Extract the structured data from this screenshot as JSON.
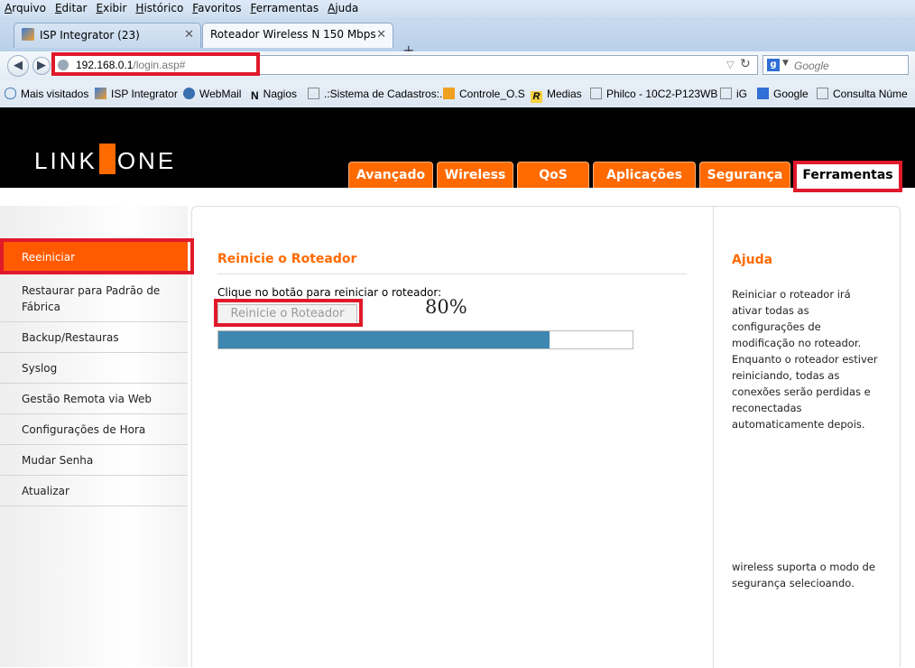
{
  "browser": {
    "menu": [
      "Arquivo",
      "Editar",
      "Exibir",
      "Histórico",
      "Favoritos",
      "Ferramentas",
      "Ajuda"
    ],
    "tabs": [
      {
        "label": "ISP Integrator (23)",
        "active": false
      },
      {
        "label": "Roteador Wireless N 150 Mbps",
        "active": true
      }
    ],
    "new_tab": "+",
    "close_glyph": "✕",
    "url_host": "192.168.0.1",
    "url_path": "/login.asp#",
    "search_placeholder": "Google",
    "bookmarks": [
      "Mais visitados",
      "ISP Integrator",
      "WebMail",
      "Nagios",
      ".:Sistema de Cadastros:.",
      "Controle_O.S",
      "Medias",
      "Philco - 10C2-P123WB",
      "iG",
      "Google",
      "Consulta Núme"
    ]
  },
  "router": {
    "logo_left": "LINK",
    "logo_right": "ONE",
    "nav_tabs": [
      "Avançado",
      "Wireless",
      "QoS",
      "Aplicações",
      "Segurança",
      "Ferramentas"
    ],
    "active_tab": "Ferramentas",
    "sidebar": [
      "Reeiniciar",
      "Restaurar para Padrão de Fábrica",
      "Backup/Restauras",
      "Syslog",
      "Gestão Remota via Web",
      "Configurações de Hora",
      "Mudar Senha",
      "Atualizar"
    ],
    "section_title": "Reinicie o Roteador",
    "instruction": "Clique no botão para reiniciar o roteador:",
    "reboot_button": "Reinicie o Roteador",
    "progress_label": "80%",
    "progress_value": 0.8,
    "help_title": "Ajuda",
    "help_text": "Reiniciar o roteador irá ativar todas as configurações de modificação no roteador. Enquanto o roteador estiver reiniciando, todas as conexões serão perdidas e reconectadas automaticamente depois.",
    "help_text_tail": "wireless suporta o modo de segurança selecioando."
  },
  "colors": {
    "accent": "#ff6a00",
    "progress": "#3e87b0",
    "annotation": "#e0192b"
  }
}
